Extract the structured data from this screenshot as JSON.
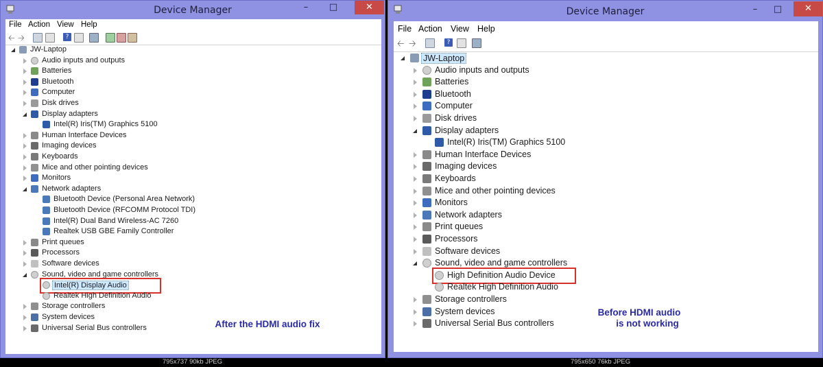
{
  "left": {
    "title": "Device Manager",
    "menu": [
      "File",
      "Action",
      "View",
      "Help"
    ],
    "caption": "795x737  90kb  JPEG",
    "note": "After the HDMI audio fix",
    "tree": [
      {
        "label": "JW-Laptop",
        "level": 0,
        "state": "open",
        "icon": "computer-icon"
      },
      {
        "label": "Audio inputs and outputs",
        "level": 1,
        "state": "closed",
        "icon": "speaker-icon"
      },
      {
        "label": "Batteries",
        "level": 1,
        "state": "closed",
        "icon": "battery-icon"
      },
      {
        "label": "Bluetooth",
        "level": 1,
        "state": "closed",
        "icon": "bluetooth-icon"
      },
      {
        "label": "Computer",
        "level": 1,
        "state": "closed",
        "icon": "monitor-icon"
      },
      {
        "label": "Disk drives",
        "level": 1,
        "state": "closed",
        "icon": "disk-icon"
      },
      {
        "label": "Display adapters",
        "level": 1,
        "state": "open",
        "icon": "display-adapter-icon"
      },
      {
        "label": "Intel(R) Iris(TM) Graphics 5100",
        "level": 2,
        "state": "leaf",
        "icon": "display-adapter-icon"
      },
      {
        "label": "Human Interface Devices",
        "level": 1,
        "state": "closed",
        "icon": "hid-icon"
      },
      {
        "label": "Imaging devices",
        "level": 1,
        "state": "closed",
        "icon": "camera-icon"
      },
      {
        "label": "Keyboards",
        "level": 1,
        "state": "closed",
        "icon": "keyboard-icon"
      },
      {
        "label": "Mice and other pointing devices",
        "level": 1,
        "state": "closed",
        "icon": "mouse-icon"
      },
      {
        "label": "Monitors",
        "level": 1,
        "state": "closed",
        "icon": "monitor-icon"
      },
      {
        "label": "Network adapters",
        "level": 1,
        "state": "open",
        "icon": "network-icon"
      },
      {
        "label": "Bluetooth Device (Personal Area Network)",
        "level": 2,
        "state": "leaf",
        "icon": "network-icon"
      },
      {
        "label": "Bluetooth Device (RFCOMM Protocol TDI)",
        "level": 2,
        "state": "leaf",
        "icon": "network-icon"
      },
      {
        "label": "Intel(R) Dual Band Wireless-AC 7260",
        "level": 2,
        "state": "leaf",
        "icon": "network-icon"
      },
      {
        "label": "Realtek USB GBE Family Controller",
        "level": 2,
        "state": "leaf",
        "icon": "network-icon"
      },
      {
        "label": "Print queues",
        "level": 1,
        "state": "closed",
        "icon": "printer-icon"
      },
      {
        "label": "Processors",
        "level": 1,
        "state": "closed",
        "icon": "processor-icon"
      },
      {
        "label": "Software devices",
        "level": 1,
        "state": "closed",
        "icon": "software-icon"
      },
      {
        "label": "Sound, video and game controllers",
        "level": 1,
        "state": "open",
        "icon": "speaker-icon"
      },
      {
        "label": "Intel(R) Display Audio",
        "level": 2,
        "state": "leaf",
        "icon": "speaker-icon",
        "selected": true,
        "highlight": true
      },
      {
        "label": "Realtek High Definition Audio",
        "level": 2,
        "state": "leaf",
        "icon": "speaker-icon"
      },
      {
        "label": "Storage controllers",
        "level": 1,
        "state": "closed",
        "icon": "storage-icon"
      },
      {
        "label": "System devices",
        "level": 1,
        "state": "closed",
        "icon": "system-icon"
      },
      {
        "label": "Universal Serial Bus controllers",
        "level": 1,
        "state": "closed",
        "icon": "usb-icon"
      }
    ]
  },
  "right": {
    "title": "Device Manager",
    "menu": [
      "File",
      "Action",
      "View",
      "Help"
    ],
    "caption": "795x650  76kb  JPEG",
    "note_line1": "Before HDMI audio",
    "note_line2": "is not working",
    "tree": [
      {
        "label": "JW-Laptop",
        "level": 0,
        "state": "open",
        "icon": "computer-icon",
        "selected": true
      },
      {
        "label": "Audio inputs and outputs",
        "level": 1,
        "state": "closed",
        "icon": "speaker-icon"
      },
      {
        "label": "Batteries",
        "level": 1,
        "state": "closed",
        "icon": "battery-icon"
      },
      {
        "label": "Bluetooth",
        "level": 1,
        "state": "closed",
        "icon": "bluetooth-icon"
      },
      {
        "label": "Computer",
        "level": 1,
        "state": "closed",
        "icon": "monitor-icon"
      },
      {
        "label": "Disk drives",
        "level": 1,
        "state": "closed",
        "icon": "disk-icon"
      },
      {
        "label": "Display adapters",
        "level": 1,
        "state": "open",
        "icon": "display-adapter-icon"
      },
      {
        "label": "Intel(R) Iris(TM) Graphics 5100",
        "level": 2,
        "state": "leaf",
        "icon": "display-adapter-icon"
      },
      {
        "label": "Human Interface Devices",
        "level": 1,
        "state": "closed",
        "icon": "hid-icon"
      },
      {
        "label": "Imaging devices",
        "level": 1,
        "state": "closed",
        "icon": "camera-icon"
      },
      {
        "label": "Keyboards",
        "level": 1,
        "state": "closed",
        "icon": "keyboard-icon"
      },
      {
        "label": "Mice and other pointing devices",
        "level": 1,
        "state": "closed",
        "icon": "mouse-icon"
      },
      {
        "label": "Monitors",
        "level": 1,
        "state": "closed",
        "icon": "monitor-icon"
      },
      {
        "label": "Network adapters",
        "level": 1,
        "state": "closed",
        "icon": "network-icon"
      },
      {
        "label": "Print queues",
        "level": 1,
        "state": "closed",
        "icon": "printer-icon"
      },
      {
        "label": "Processors",
        "level": 1,
        "state": "closed",
        "icon": "processor-icon"
      },
      {
        "label": "Software devices",
        "level": 1,
        "state": "closed",
        "icon": "software-icon"
      },
      {
        "label": "Sound, video and game controllers",
        "level": 1,
        "state": "open",
        "icon": "speaker-icon"
      },
      {
        "label": "High Definition Audio Device",
        "level": 2,
        "state": "leaf",
        "icon": "speaker-icon",
        "highlight": true
      },
      {
        "label": "Realtek High Definition Audio",
        "level": 2,
        "state": "leaf",
        "icon": "speaker-icon"
      },
      {
        "label": "Storage controllers",
        "level": 1,
        "state": "closed",
        "icon": "storage-icon"
      },
      {
        "label": "System devices",
        "level": 1,
        "state": "closed",
        "icon": "system-icon"
      },
      {
        "label": "Universal Serial Bus controllers",
        "level": 1,
        "state": "closed",
        "icon": "usb-icon"
      }
    ]
  },
  "colors": {
    "window_frame": "#8f92e2",
    "close_button": "#c74a46",
    "highlight_box": "#d9302c",
    "annotation_text": "#2a2aa8",
    "selection": "#cde8ff"
  }
}
